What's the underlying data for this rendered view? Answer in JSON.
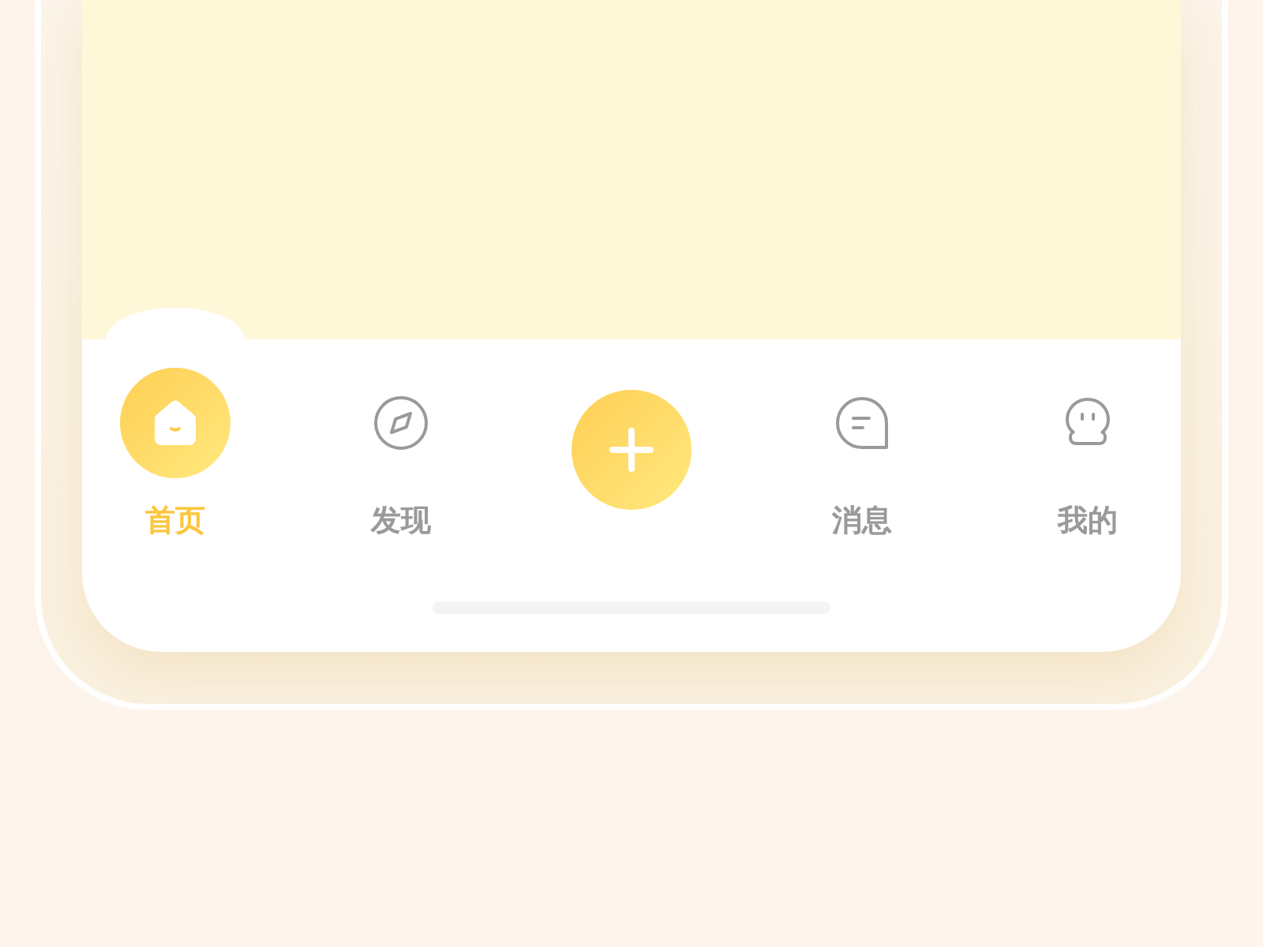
{
  "tab_bar": {
    "tabs": [
      {
        "kind": "tab",
        "label": "首页",
        "selected": true
      },
      {
        "kind": "tab",
        "label": "发现",
        "selected": false
      },
      {
        "kind": "add"
      },
      {
        "kind": "tab",
        "label": "消息",
        "selected": false
      },
      {
        "kind": "tab",
        "label": "我的",
        "selected": false
      }
    ]
  }
}
